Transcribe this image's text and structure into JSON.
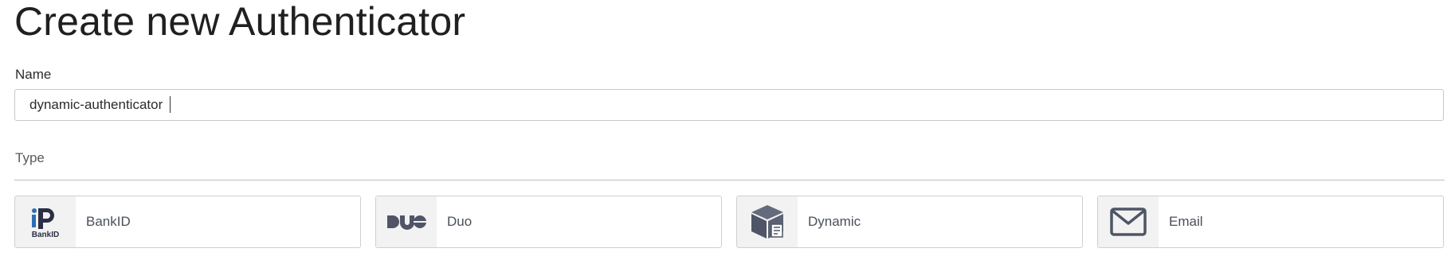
{
  "page": {
    "title": "Create new Authenticator"
  },
  "form": {
    "name_label": "Name",
    "name_value": "dynamic-authenticator",
    "type_label": "Type"
  },
  "types": [
    {
      "label": "BankID",
      "icon": "bankid-icon",
      "icon_text": "BankID"
    },
    {
      "label": "Duo",
      "icon": "duo-icon",
      "icon_text": "DUO"
    },
    {
      "label": "Dynamic",
      "icon": "package-icon"
    },
    {
      "label": "Email",
      "icon": "envelope-icon"
    }
  ],
  "colors": {
    "icon_fill": "#4f5566",
    "bankid_accent": "#2c6fb0",
    "icon_box_bg": "#f2f2f2"
  }
}
